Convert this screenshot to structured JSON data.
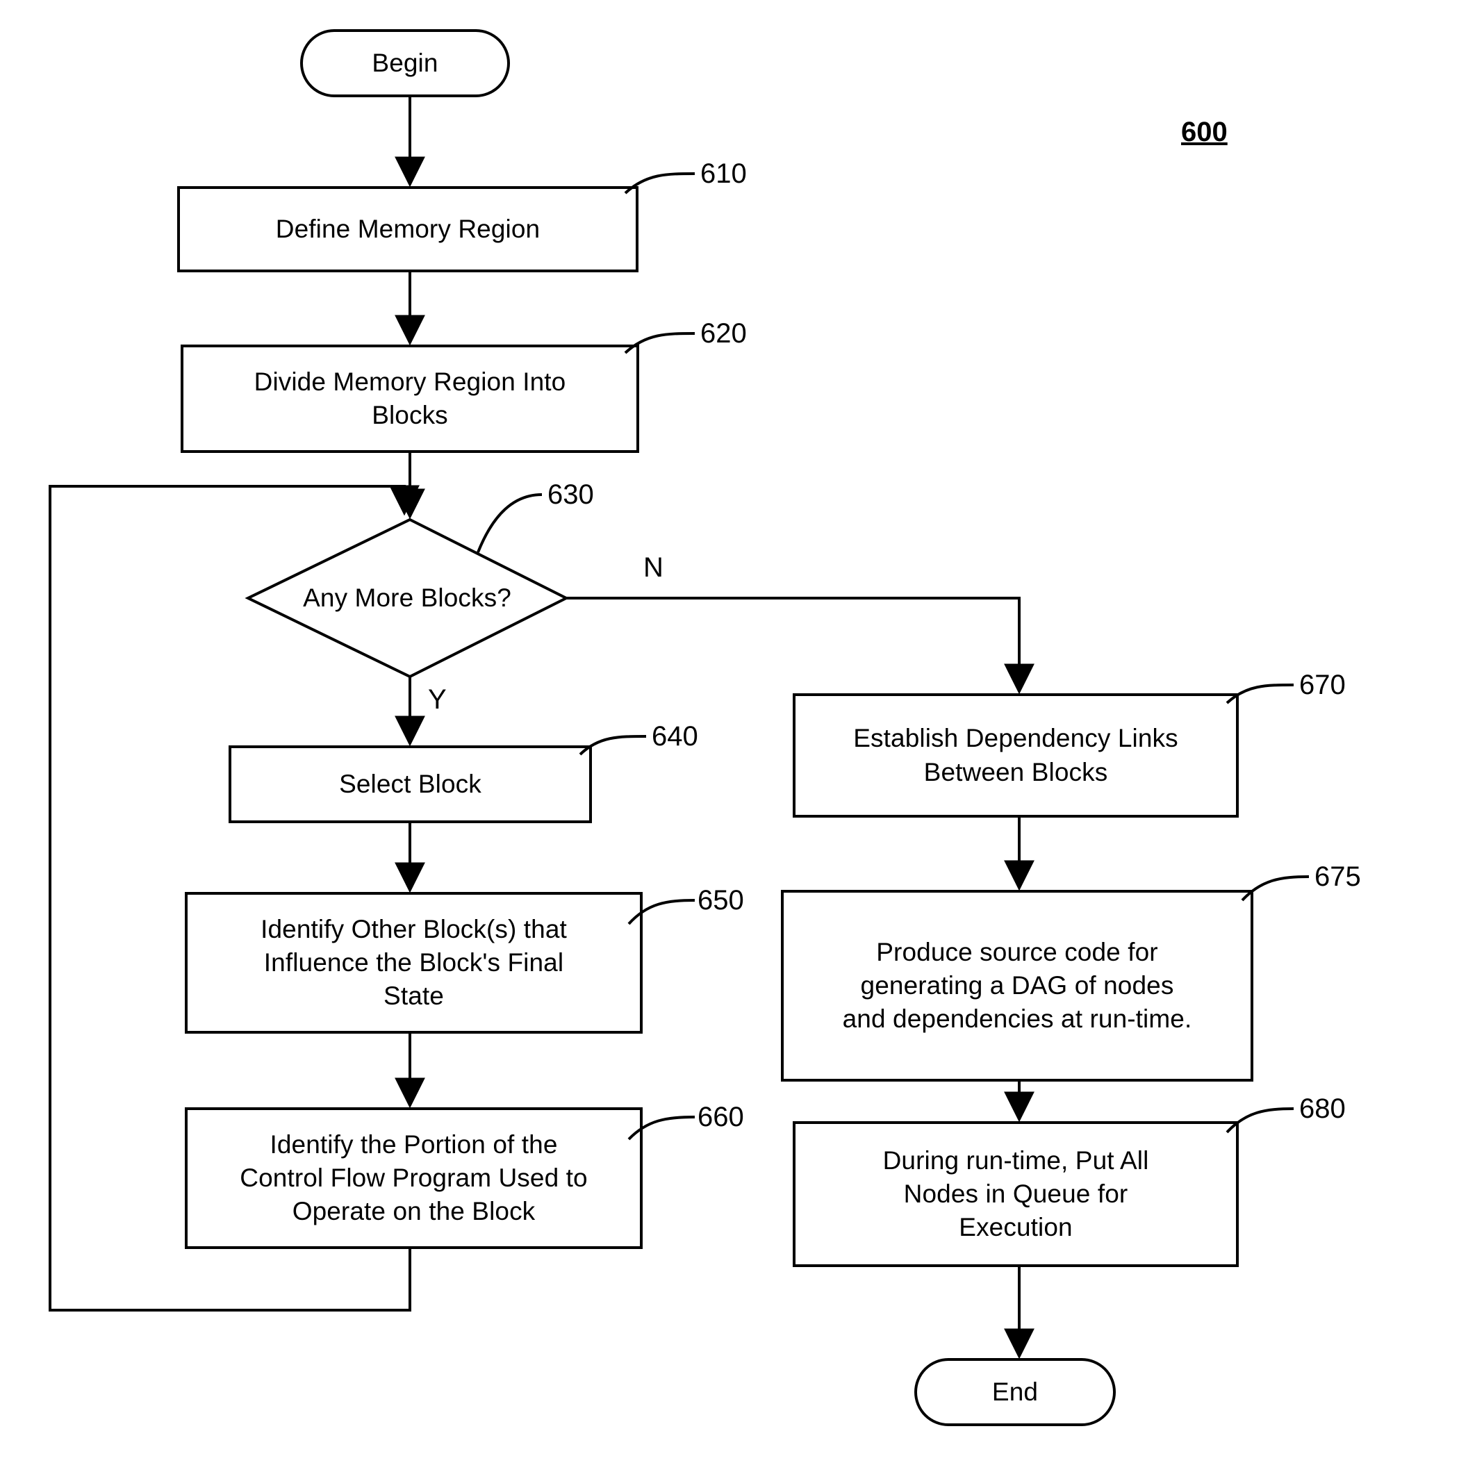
{
  "figure": {
    "number": "600"
  },
  "diagram": {
    "type": "flowchart",
    "nodes": [
      {
        "id": "begin",
        "shape": "terminator",
        "label": "Begin",
        "ref": ""
      },
      {
        "id": "n610",
        "shape": "process",
        "label": "Define Memory Region",
        "ref": "610"
      },
      {
        "id": "n620",
        "shape": "process",
        "label": "Divide Memory Region Into\nBlocks",
        "ref": "620"
      },
      {
        "id": "n630",
        "shape": "decision",
        "label": "Any More Blocks?",
        "ref": "630"
      },
      {
        "id": "n640",
        "shape": "process",
        "label": "Select Block",
        "ref": "640"
      },
      {
        "id": "n650",
        "shape": "process",
        "label": "Identify Other Block(s) that\nInfluence the Block's Final\nState",
        "ref": "650"
      },
      {
        "id": "n660",
        "shape": "process",
        "label": "Identify the Portion of the\nControl Flow Program Used to\nOperate on the Block",
        "ref": "660"
      },
      {
        "id": "n670",
        "shape": "process",
        "label": "Establish Dependency Links\nBetween Blocks",
        "ref": "670"
      },
      {
        "id": "n675",
        "shape": "process",
        "label": "Produce source code for\ngenerating a DAG of nodes\nand dependencies at run-time.",
        "ref": "675"
      },
      {
        "id": "n680",
        "shape": "process",
        "label": "During run-time, Put All\nNodes in Queue for\nExecution",
        "ref": "680"
      },
      {
        "id": "end",
        "shape": "terminator",
        "label": "End",
        "ref": ""
      }
    ],
    "edge_labels": {
      "no": "N",
      "yes": "Y"
    }
  }
}
